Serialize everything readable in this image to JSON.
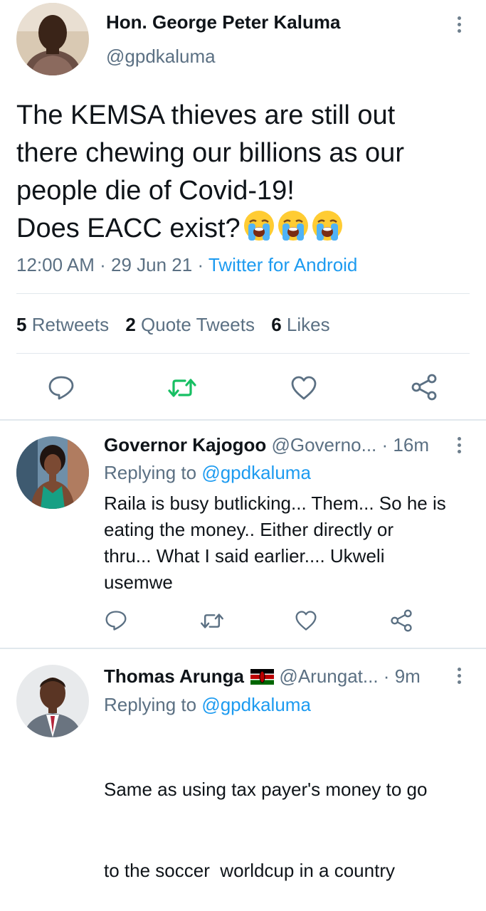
{
  "tweet": {
    "author_name": "Hon. George Peter Kaluma",
    "author_handle": "@gpdkaluma",
    "text_lines": [
      "The KEMSA thieves are still out",
      "there chewing our billions as our",
      "people die of Covid-19!",
      "Does EACC exist?"
    ],
    "emojis": [
      "loudly-crying-face",
      "loudly-crying-face",
      "loudly-crying-face"
    ],
    "time": "12:00 AM",
    "date": "29 Jun 21",
    "source": "Twitter for Android",
    "stats": {
      "retweets_count": "5",
      "retweets_label": "Retweets",
      "quotes_count": "2",
      "quotes_label": "Quote Tweets",
      "likes_count": "6",
      "likes_label": "Likes"
    },
    "actions": [
      "reply-icon",
      "retweet-icon",
      "like-icon",
      "share-icon"
    ],
    "retweet_color": "#17bf63"
  },
  "replies": [
    {
      "name": "Governor Kajogoo",
      "handle": "@Governo...",
      "time": "16m",
      "replying_prefix": "Replying to",
      "replying_to": "@gpdkaluma",
      "lines": [
        "Raila is busy butlicking... Them... So he is",
        "eating the money.. Either directly or",
        "thru... What I said earlier.... Ukweli",
        "usemwe"
      ]
    },
    {
      "name": "Thomas Arunga",
      "flag": "kenya-flag",
      "handle": "@Arungat...",
      "time": "9m",
      "replying_prefix": "Replying to",
      "replying_to": "@gpdkaluma",
      "lines": [
        "Same as using tax payer's money to go",
        "to the soccer  worldcup in a country"
      ]
    }
  ],
  "colors": {
    "link": "#1d9bf0",
    "secondary": "#5b7083",
    "divider": "#e1e8ed"
  }
}
